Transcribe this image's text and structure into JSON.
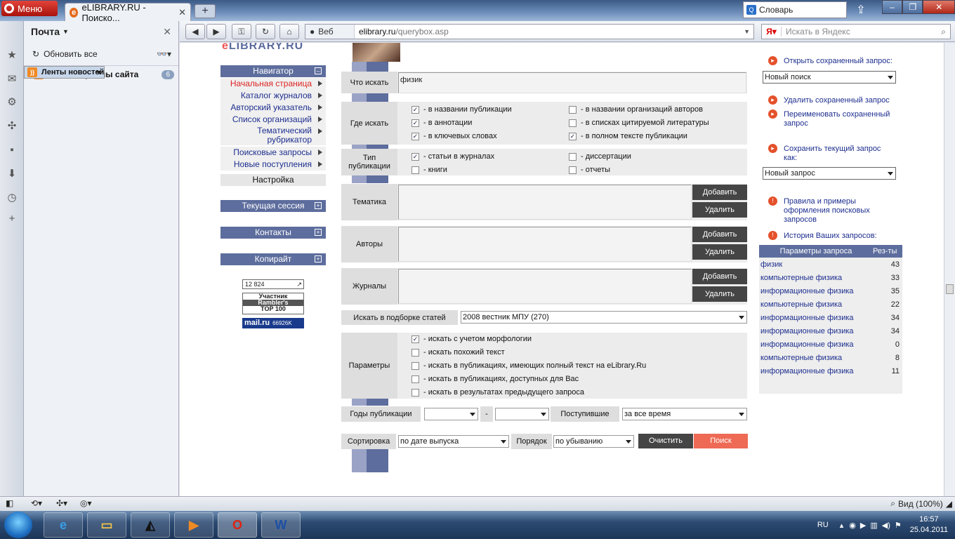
{
  "browser": {
    "menu_label": "Меню",
    "tab_title": "eLIBRARY.RU - Поиско...",
    "dict_label": "Словарь",
    "url_host": "elibrary.ru",
    "url_path": "/querybox.asp",
    "web_label": "Веб",
    "search_placeholder": "Искать в Яндекс",
    "zoom_label": "Вид (100%)"
  },
  "mail": {
    "title": "Почта",
    "refresh": "Обновить все",
    "feeds_label": "Ленты новостей",
    "all_materials": "Все материалы сайта",
    "count": "6"
  },
  "site": {
    "logo": "LIBRARY.RU",
    "nav": {
      "header": "Навигатор",
      "items": [
        "Начальная страница",
        "Каталог журналов",
        "Авторский указатель",
        "Список организаций",
        "Тематический рубрикатор",
        "Поисковые запросы",
        "Новые поступления"
      ],
      "settings": "Настройка",
      "session": "Текущая сессия",
      "contacts": "Контакты",
      "copyright": "Копирайт"
    },
    "badges": {
      "counter": "12 824",
      "rambler1": "Участник",
      "rambler2": "Rambler's",
      "rambler3": "TOP 100",
      "mail": "mail.ru",
      "mail_count": "66926K"
    },
    "form": {
      "what_label": "Что искать",
      "what_value": "физик",
      "where_label": "Где искать",
      "where_opts": [
        {
          "label": "- в названии публикации",
          "checked": true
        },
        {
          "label": "- в названии организаций авторов",
          "checked": false
        },
        {
          "label": "- в аннотации",
          "checked": true
        },
        {
          "label": "- в списках цитируемой литературы",
          "checked": false
        },
        {
          "label": "- в ключевых словах",
          "checked": true
        },
        {
          "label": "- в полном тексте публикации",
          "checked": true
        }
      ],
      "type_label": "Тип публикации",
      "type_opts": [
        {
          "label": "- статьи в журналах",
          "checked": true
        },
        {
          "label": "- диссертации",
          "checked": false
        },
        {
          "label": "- книги",
          "checked": false
        },
        {
          "label": "- отчеты",
          "checked": false
        }
      ],
      "topic_label": "Тематика",
      "authors_label": "Авторы",
      "journals_label": "Журналы",
      "add": "Добавить",
      "remove": "Удалить",
      "collection_label": "Искать в подборке статей",
      "collection_value": "2008 вестник МПУ (270)",
      "params_label": "Параметры",
      "params": [
        {
          "label": "- искать с учетом морфологии",
          "checked": true
        },
        {
          "label": "- искать похожий текст",
          "checked": false
        },
        {
          "label": "- искать в публикациях, имеющих полный текст на eLibrary.Ru",
          "checked": false
        },
        {
          "label": "- искать в публикациях, доступных для Вас",
          "checked": false
        },
        {
          "label": "- искать в результатах предыдущего запроса",
          "checked": false
        }
      ],
      "years_label": "Годы публикации",
      "dash": "-",
      "received_label": "Поступившие",
      "received_value": "за все время",
      "sort_label": "Сортировка",
      "sort_value": "по дате выпуска",
      "order_label": "Порядок",
      "order_value": "по убыванию",
      "clear": "Очистить",
      "search": "Поиск"
    },
    "right": {
      "open_saved": "Открыть сохраненный запрос:",
      "open_value": "Новый поиск",
      "delete_saved": "Удалить сохраненный запрос",
      "rename_saved": "Переименовать сохраненный запрос",
      "save_current": "Сохранить текущий запрос как:",
      "save_value": "Новый запрос",
      "rules": "Правила и примеры оформления поисковых запросов",
      "history": "История Ваших запросов:",
      "col_params": "Параметры запроса",
      "col_results": "Рез-ты",
      "rows": [
        {
          "q": "физик",
          "n": "43"
        },
        {
          "q": "компьютерные физика",
          "n": "33"
        },
        {
          "q": "информационные физика",
          "n": "35"
        },
        {
          "q": "компьютерные физика",
          "n": "22"
        },
        {
          "q": "информационные физика",
          "n": "34"
        },
        {
          "q": "информационные физика",
          "n": "34"
        },
        {
          "q": "информационные физика",
          "n": "0"
        },
        {
          "q": "компьютерные физика",
          "n": "8"
        },
        {
          "q": "информационные физика",
          "n": "11"
        }
      ]
    }
  },
  "taskbar": {
    "lang": "RU",
    "time": "16:57",
    "date": "25.04.2011"
  }
}
